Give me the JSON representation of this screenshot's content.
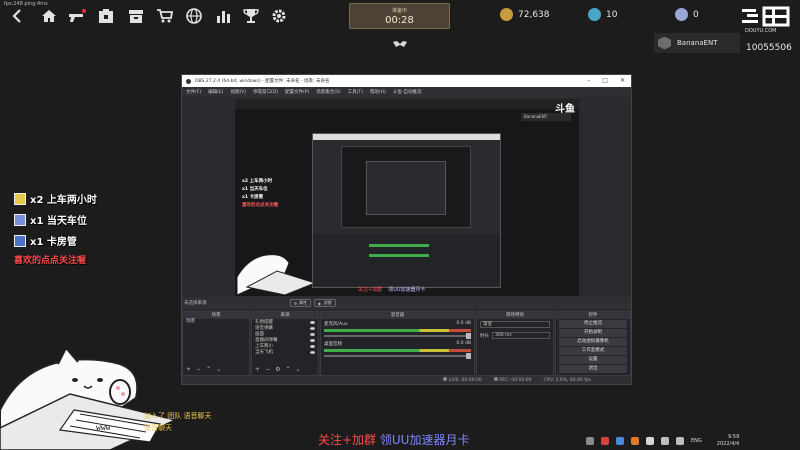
{
  "hud": {
    "fps_text": "fps:248 ping:4ms",
    "timer_label": "准备中",
    "timer_value": "00:28",
    "currencies": [
      {
        "name": "gold",
        "value": "72,638",
        "color": "#c99a3c"
      },
      {
        "name": "diamond",
        "value": "10",
        "color": "#4aa6c9"
      },
      {
        "name": "token",
        "value": "0",
        "color": "#9aa7d6"
      }
    ],
    "icons": [
      "back-icon",
      "home-icon",
      "weapon-icon",
      "store-icon",
      "storage-icon",
      "cart-icon",
      "globe-icon",
      "stats-icon",
      "trophy-icon",
      "settings-icon"
    ]
  },
  "player": {
    "name": "BananaENT"
  },
  "douyu": {
    "url": "DOUYU.COM",
    "room_id": "10055506"
  },
  "left_overlay": {
    "rows": [
      {
        "text": "x2 上车两小时",
        "icon_color": "#e6c84d"
      },
      {
        "text": "x1 当天车位",
        "icon_color": "#7a90d8"
      },
      {
        "text": "x1 卡房管",
        "icon_color": "#4d74c7"
      }
    ],
    "cta": "喜欢的点点关注喔"
  },
  "chat": [
    "加入了 团队 语音聊天",
    "语音聊天"
  ],
  "cat": {
    "keyboard_text": "www"
  },
  "obs": {
    "title": "OBS 27.2.4 (64-bit, windows) - 配置文件: 未命名 - 场景: 未命名",
    "menu": [
      "文件(F)",
      "编辑(E)",
      "视图(V)",
      "停靠窗口(D)",
      "配置文件(P)",
      "场景集合(S)",
      "工具(T)",
      "帮助(H)",
      "斗鱼-自动推流"
    ],
    "scene_label": "未选择来源",
    "scene_buttons": [
      "属性",
      "滤镜"
    ],
    "docks": {
      "scenes": {
        "title": "场景",
        "items": [
          "场景"
        ]
      },
      "sources": {
        "title": "来源",
        "items": [
          "礼物提醒",
          "语音弹幕",
          "画面",
          "直播间弹幕",
          "上车两小",
          "当天飞机"
        ]
      },
      "mixer": {
        "title": "混音器",
        "channels": [
          {
            "name": "麦克风/Aux",
            "db": "0.0 dB"
          },
          {
            "name": "桌面音频",
            "db": "0.0 dB"
          }
        ]
      },
      "transitions": {
        "title": "转场特效",
        "type": "渐变",
        "duration_label": "时长",
        "duration": "300 ms"
      },
      "controls": {
        "title": "控件",
        "buttons": [
          "停止推流",
          "开始录制",
          "启动虚拟摄像机",
          "工作室模式",
          "设置",
          "退出"
        ]
      }
    },
    "status": {
      "live": "LIVE: 00:00:00",
      "rec": "REC: 00:00:00",
      "cpu": "CPU: 2.6%, 60.00 fps"
    }
  },
  "nested": {
    "logo": "斗鱼",
    "tag": "BananaENT",
    "list": [
      "x2 上车两小时",
      "x1 当天车位",
      "x1 卡房管",
      "喜欢的点点关注喔"
    ],
    "cta_red": "关注+加群",
    "cta_blue": "领UU加速器月卡"
  },
  "bottom_cta": {
    "red": "关注+加群",
    "blue": "领UU加速器月卡"
  },
  "taskbar": {
    "lang": "ENG",
    "time": "9:59",
    "date": "2022/4/4"
  }
}
